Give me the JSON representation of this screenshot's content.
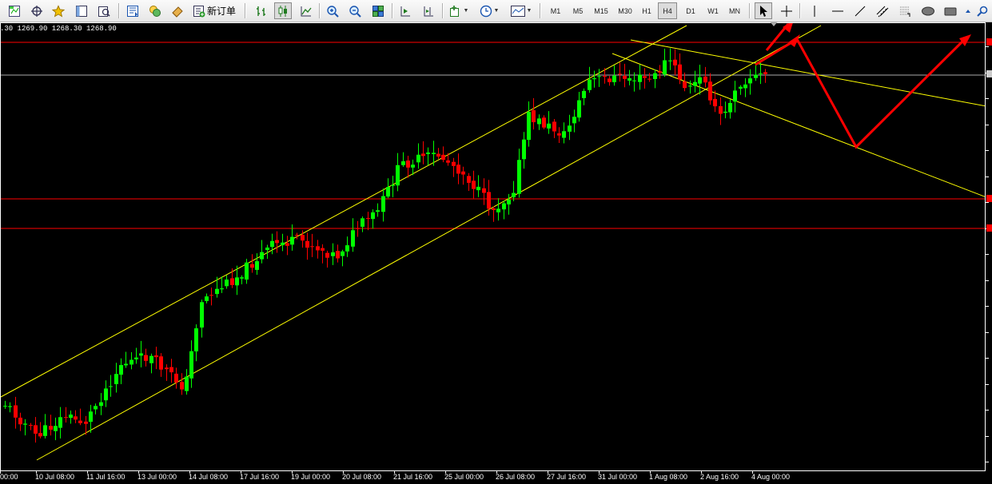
{
  "toolbar": {
    "new_order_label": "新订单",
    "timeframes": [
      "M1",
      "M5",
      "M15",
      "M30",
      "H1",
      "H4",
      "D1",
      "W1",
      "MN"
    ],
    "active_timeframe": "H4"
  },
  "chart": {
    "ohlc_text": ".30 1269.90 1268.30 1268.90",
    "time_labels": [
      "00:00",
      "10 Jul 08:00",
      "11 Jul 16:00",
      "13 Jul 00:00",
      "14 Jul 08:00",
      "17 Jul 16:00",
      "19 Jul 00:00",
      "20 Jul 08:00",
      "21 Jul 16:00",
      "25 Jul 00:00",
      "26 Jul 08:00",
      "27 Jul 16:00",
      "31 Jul 00:00",
      "1 Aug 08:00",
      "2 Aug 16:00",
      "4 Aug 00:00"
    ],
    "colors": {
      "background": "#000000",
      "bull_candle": "#00ff00",
      "bear_candle": "#ff0000",
      "trend_lines": "#ffff00",
      "horizontal_levels": "#ff0000",
      "bid_line": "#aaaaaa",
      "forecast_arrow": "#ff0000"
    }
  },
  "chart_data": {
    "type": "candlestick",
    "timeframe": "H4",
    "approx_closes": [
      1222,
      1228,
      1225,
      1229,
      1236,
      1240,
      1238,
      1243,
      1246,
      1249,
      1257,
      1262,
      1266,
      1259,
      1263,
      1270,
      1268,
      1266,
      1269,
      1271,
      1270,
      1271,
      1272,
      1268,
      1271
    ]
  }
}
